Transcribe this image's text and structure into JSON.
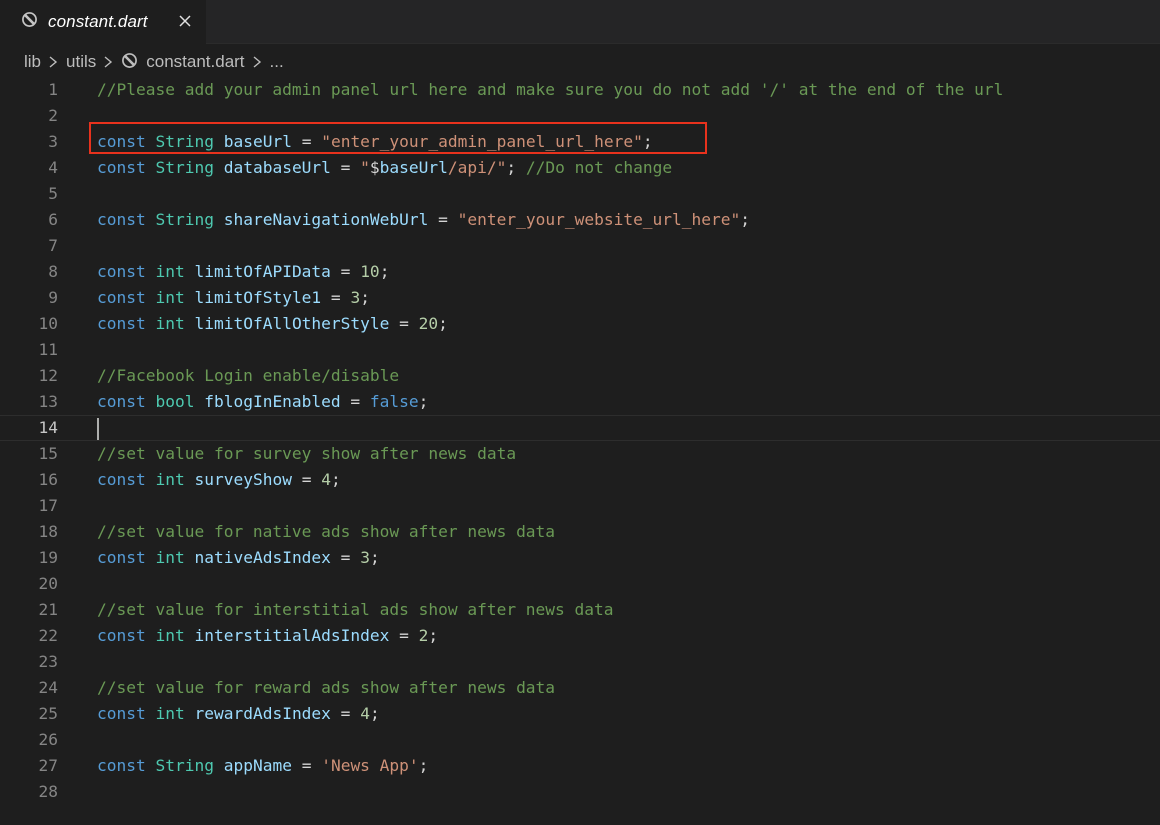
{
  "tab": {
    "label": "constant.dart",
    "icon": "dart-file-icon",
    "close_icon": "close-icon"
  },
  "breadcrumb": {
    "items": [
      "lib",
      "utils",
      "constant.dart",
      "..."
    ]
  },
  "editor": {
    "current_line": 14,
    "lines": [
      {
        "n": "1",
        "tokens": [
          {
            "c": "cm",
            "t": "//Please add your admin panel url here and make sure you do not add '/' at the end of the url"
          }
        ]
      },
      {
        "n": "2",
        "tokens": []
      },
      {
        "n": "3",
        "tokens": [
          {
            "c": "kw",
            "t": "const"
          },
          {
            "c": "op",
            "t": " "
          },
          {
            "c": "ty",
            "t": "String"
          },
          {
            "c": "op",
            "t": " "
          },
          {
            "c": "id",
            "t": "baseUrl"
          },
          {
            "c": "op",
            "t": " = "
          },
          {
            "c": "str",
            "t": "\"enter_your_admin_panel_url_here\""
          },
          {
            "c": "op",
            "t": ";"
          }
        ]
      },
      {
        "n": "4",
        "tokens": [
          {
            "c": "kw",
            "t": "const"
          },
          {
            "c": "op",
            "t": " "
          },
          {
            "c": "ty",
            "t": "String"
          },
          {
            "c": "op",
            "t": " "
          },
          {
            "c": "id",
            "t": "databaseUrl"
          },
          {
            "c": "op",
            "t": " = "
          },
          {
            "c": "str",
            "t": "\""
          },
          {
            "c": "op",
            "t": "$"
          },
          {
            "c": "id",
            "t": "baseUrl"
          },
          {
            "c": "str",
            "t": "/api/\""
          },
          {
            "c": "op",
            "t": "; "
          },
          {
            "c": "cm",
            "t": "//Do not change"
          }
        ]
      },
      {
        "n": "5",
        "tokens": []
      },
      {
        "n": "6",
        "tokens": [
          {
            "c": "kw",
            "t": "const"
          },
          {
            "c": "op",
            "t": " "
          },
          {
            "c": "ty",
            "t": "String"
          },
          {
            "c": "op",
            "t": " "
          },
          {
            "c": "id",
            "t": "shareNavigationWebUrl"
          },
          {
            "c": "op",
            "t": " = "
          },
          {
            "c": "str",
            "t": "\"enter_your_website_url_here\""
          },
          {
            "c": "op",
            "t": ";"
          }
        ]
      },
      {
        "n": "7",
        "tokens": []
      },
      {
        "n": "8",
        "tokens": [
          {
            "c": "kw",
            "t": "const"
          },
          {
            "c": "op",
            "t": " "
          },
          {
            "c": "ty",
            "t": "int"
          },
          {
            "c": "op",
            "t": " "
          },
          {
            "c": "id",
            "t": "limitOfAPIData"
          },
          {
            "c": "op",
            "t": " = "
          },
          {
            "c": "num",
            "t": "10"
          },
          {
            "c": "op",
            "t": ";"
          }
        ]
      },
      {
        "n": "9",
        "tokens": [
          {
            "c": "kw",
            "t": "const"
          },
          {
            "c": "op",
            "t": " "
          },
          {
            "c": "ty",
            "t": "int"
          },
          {
            "c": "op",
            "t": " "
          },
          {
            "c": "id",
            "t": "limitOfStyle1"
          },
          {
            "c": "op",
            "t": " = "
          },
          {
            "c": "num",
            "t": "3"
          },
          {
            "c": "op",
            "t": ";"
          }
        ]
      },
      {
        "n": "10",
        "tokens": [
          {
            "c": "kw",
            "t": "const"
          },
          {
            "c": "op",
            "t": " "
          },
          {
            "c": "ty",
            "t": "int"
          },
          {
            "c": "op",
            "t": " "
          },
          {
            "c": "id",
            "t": "limitOfAllOtherStyle"
          },
          {
            "c": "op",
            "t": " = "
          },
          {
            "c": "num",
            "t": "20"
          },
          {
            "c": "op",
            "t": ";"
          }
        ]
      },
      {
        "n": "11",
        "tokens": []
      },
      {
        "n": "12",
        "tokens": [
          {
            "c": "cm",
            "t": "//Facebook Login enable/disable"
          }
        ]
      },
      {
        "n": "13",
        "tokens": [
          {
            "c": "kw",
            "t": "const"
          },
          {
            "c": "op",
            "t": " "
          },
          {
            "c": "ty",
            "t": "bool"
          },
          {
            "c": "op",
            "t": " "
          },
          {
            "c": "id",
            "t": "fblogInEnabled"
          },
          {
            "c": "op",
            "t": " = "
          },
          {
            "c": "kw",
            "t": "false"
          },
          {
            "c": "op",
            "t": ";"
          }
        ]
      },
      {
        "n": "14",
        "tokens": []
      },
      {
        "n": "15",
        "tokens": [
          {
            "c": "cm",
            "t": "//set value for survey show after news data"
          }
        ]
      },
      {
        "n": "16",
        "tokens": [
          {
            "c": "kw",
            "t": "const"
          },
          {
            "c": "op",
            "t": " "
          },
          {
            "c": "ty",
            "t": "int"
          },
          {
            "c": "op",
            "t": " "
          },
          {
            "c": "id",
            "t": "surveyShow"
          },
          {
            "c": "op",
            "t": " = "
          },
          {
            "c": "num",
            "t": "4"
          },
          {
            "c": "op",
            "t": ";"
          }
        ]
      },
      {
        "n": "17",
        "tokens": []
      },
      {
        "n": "18",
        "tokens": [
          {
            "c": "cm",
            "t": "//set value for native ads show after news data"
          }
        ]
      },
      {
        "n": "19",
        "tokens": [
          {
            "c": "kw",
            "t": "const"
          },
          {
            "c": "op",
            "t": " "
          },
          {
            "c": "ty",
            "t": "int"
          },
          {
            "c": "op",
            "t": " "
          },
          {
            "c": "id",
            "t": "nativeAdsIndex"
          },
          {
            "c": "op",
            "t": " = "
          },
          {
            "c": "num",
            "t": "3"
          },
          {
            "c": "op",
            "t": ";"
          }
        ]
      },
      {
        "n": "20",
        "tokens": []
      },
      {
        "n": "21",
        "tokens": [
          {
            "c": "cm",
            "t": "//set value for interstitial ads show after news data"
          }
        ]
      },
      {
        "n": "22",
        "tokens": [
          {
            "c": "kw",
            "t": "const"
          },
          {
            "c": "op",
            "t": " "
          },
          {
            "c": "ty",
            "t": "int"
          },
          {
            "c": "op",
            "t": " "
          },
          {
            "c": "id",
            "t": "interstitialAdsIndex"
          },
          {
            "c": "op",
            "t": " = "
          },
          {
            "c": "num",
            "t": "2"
          },
          {
            "c": "op",
            "t": ";"
          }
        ]
      },
      {
        "n": "23",
        "tokens": []
      },
      {
        "n": "24",
        "tokens": [
          {
            "c": "cm",
            "t": "//set value for reward ads show after news data"
          }
        ]
      },
      {
        "n": "25",
        "tokens": [
          {
            "c": "kw",
            "t": "const"
          },
          {
            "c": "op",
            "t": " "
          },
          {
            "c": "ty",
            "t": "int"
          },
          {
            "c": "op",
            "t": " "
          },
          {
            "c": "id",
            "t": "rewardAdsIndex"
          },
          {
            "c": "op",
            "t": " = "
          },
          {
            "c": "num",
            "t": "4"
          },
          {
            "c": "op",
            "t": ";"
          }
        ]
      },
      {
        "n": "26",
        "tokens": []
      },
      {
        "n": "27",
        "tokens": [
          {
            "c": "kw",
            "t": "const"
          },
          {
            "c": "op",
            "t": " "
          },
          {
            "c": "ty",
            "t": "String"
          },
          {
            "c": "op",
            "t": " "
          },
          {
            "c": "id",
            "t": "appName"
          },
          {
            "c": "op",
            "t": " = "
          },
          {
            "c": "str",
            "t": "'News App'"
          },
          {
            "c": "op",
            "t": ";"
          }
        ]
      },
      {
        "n": "28",
        "tokens": []
      }
    ]
  },
  "colors": {
    "background": "#1e1e1e",
    "keyword": "#569cd6",
    "type": "#4ec9b0",
    "identifier": "#9cdcfe",
    "string": "#ce9178",
    "number": "#b5cea8",
    "comment": "#6a9955",
    "highlight_box": "#e8321d"
  }
}
